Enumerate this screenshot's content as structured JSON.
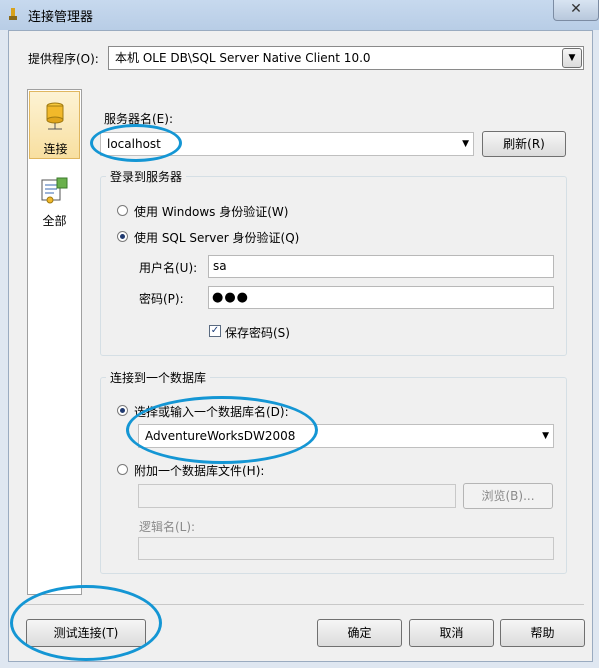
{
  "window": {
    "title": "连接管理器",
    "close_glyph": "✕"
  },
  "provider": {
    "label": "提供程序(O):",
    "value": "本机 OLE DB\\SQL Server Native Client 10.0"
  },
  "sidebar": {
    "items": [
      {
        "label": "连接",
        "icon": "connection-icon",
        "selected": true
      },
      {
        "label": "全部",
        "icon": "all-properties-icon",
        "selected": false
      }
    ]
  },
  "server": {
    "label": "服务器名(E):",
    "value": "localhost",
    "refresh_label": "刷新(R)"
  },
  "login": {
    "group_title": "登录到服务器",
    "windows_auth_label": "使用 Windows 身份验证(W)",
    "sql_auth_label": "使用 SQL Server 身份验证(Q)",
    "selected": "sql",
    "username_label": "用户名(U):",
    "username_value": "sa",
    "password_label": "密码(P):",
    "password_value": "●●●",
    "save_password_label": "保存密码(S)",
    "save_password_checked": true,
    "check_glyph": "✓"
  },
  "database": {
    "group_title": "连接到一个数据库",
    "select_label": "选择或输入一个数据库名(D):",
    "select_value": "AdventureWorksDW2008",
    "attach_label": "附加一个数据库文件(H):",
    "attach_value": "",
    "browse_label": "浏览(B)...",
    "logical_name_label": "逻辑名(L):",
    "logical_name_value": "",
    "selected": "select"
  },
  "buttons": {
    "test_connection": "测试连接(T)",
    "ok": "确定",
    "cancel": "取消",
    "help": "帮助"
  },
  "glyphs": {
    "dropdown": "▼"
  },
  "colors": {
    "highlight_ellipse": "#1496d4",
    "titlebar": "#c7d9ee",
    "dialog_bg": "#f0f0f0"
  }
}
